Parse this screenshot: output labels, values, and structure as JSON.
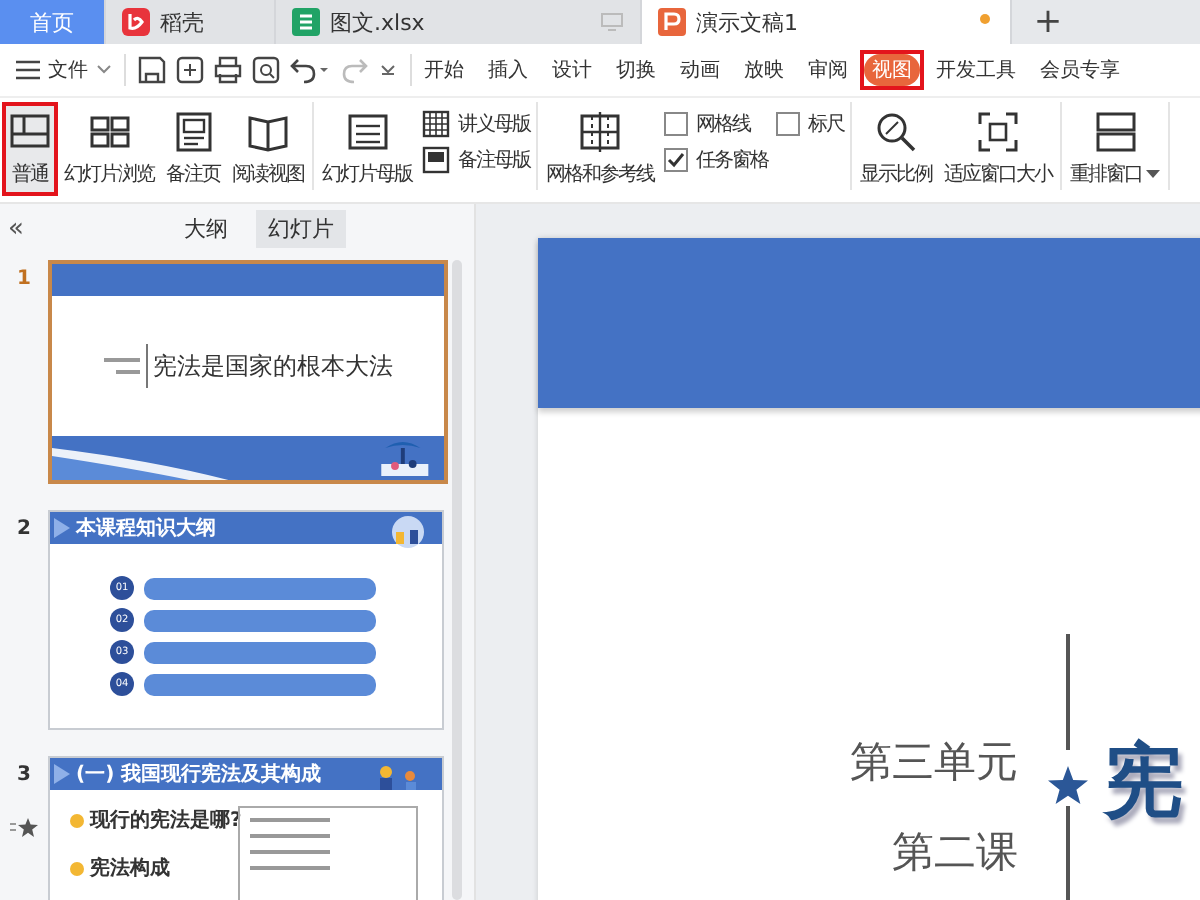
{
  "title_tabs": [
    {
      "label": "首页",
      "kind": "home",
      "selected": false,
      "unsaved": false
    },
    {
      "label": "稻壳",
      "kind": "docer",
      "selected": false,
      "unsaved": false
    },
    {
      "label": "图文.xlsx",
      "kind": "sheet",
      "selected": false,
      "unsaved": false
    },
    {
      "label": "演示文稿1",
      "kind": "slides",
      "selected": true,
      "unsaved": true
    }
  ],
  "new_tab": "+",
  "file_menu": "文件",
  "menu_tabs": [
    {
      "label": "开始",
      "selected": false,
      "highlighted": false
    },
    {
      "label": "插入",
      "selected": false,
      "highlighted": false
    },
    {
      "label": "设计",
      "selected": false,
      "highlighted": false
    },
    {
      "label": "切换",
      "selected": false,
      "highlighted": false
    },
    {
      "label": "动画",
      "selected": false,
      "highlighted": false
    },
    {
      "label": "放映",
      "selected": false,
      "highlighted": false
    },
    {
      "label": "审阅",
      "selected": false,
      "highlighted": false
    },
    {
      "label": "视图",
      "selected": true,
      "highlighted": true
    },
    {
      "label": "开发工具",
      "selected": false,
      "highlighted": false
    },
    {
      "label": "会员专享",
      "selected": false,
      "highlighted": false
    }
  ],
  "ribbon": {
    "groups": [
      {
        "columns": [
          {
            "kind": "large",
            "label": "普通",
            "selected": true,
            "highlighted": true
          },
          {
            "kind": "large",
            "label": "幻灯片浏览",
            "selected": false,
            "highlighted": false
          },
          {
            "kind": "large",
            "label": "备注页",
            "selected": false,
            "highlighted": false
          },
          {
            "kind": "large",
            "label": "阅读视图",
            "selected": false,
            "highlighted": false
          }
        ]
      },
      {
        "columns": [
          {
            "kind": "large",
            "label": "幻灯片母版",
            "selected": false,
            "highlighted": false
          },
          {
            "kind": "stack",
            "items": [
              {
                "kind": "small",
                "label": "讲义母版"
              },
              {
                "kind": "small",
                "label": "备注母版"
              }
            ]
          }
        ]
      },
      {
        "columns": [
          {
            "kind": "large",
            "label": "网格和参考线",
            "selected": false,
            "highlighted": false
          },
          {
            "kind": "stack",
            "items": [
              {
                "kind": "check",
                "label": "网格线",
                "checked": false
              },
              {
                "kind": "check",
                "label": "任务窗格",
                "checked": true
              }
            ]
          },
          {
            "kind": "stack",
            "items": [
              {
                "kind": "check",
                "label": "标尺",
                "checked": false
              }
            ]
          }
        ]
      },
      {
        "columns": [
          {
            "kind": "large",
            "label": "显示比例",
            "selected": false,
            "highlighted": false
          },
          {
            "kind": "large",
            "label": "适应窗口大小",
            "selected": false,
            "highlighted": false
          }
        ]
      },
      {
        "columns": [
          {
            "kind": "large",
            "label": "重排窗口",
            "selected": false,
            "highlighted": false,
            "dropdown": true
          }
        ]
      }
    ]
  },
  "side_panel": {
    "collapse": "«",
    "tabs": [
      {
        "label": "大纲",
        "selected": false
      },
      {
        "label": "幻灯片",
        "selected": true
      }
    ],
    "slides": [
      {
        "number": "1",
        "kind": "title",
        "selected": true,
        "animated": false,
        "title": "宪法是国家的根本大法"
      },
      {
        "number": "2",
        "kind": "outline",
        "selected": false,
        "animated": false,
        "title": "本课程知识大纲",
        "items": [
          "01",
          "02",
          "03",
          "04"
        ]
      },
      {
        "number": "3",
        "kind": "section",
        "selected": false,
        "animated": true,
        "title": "(一) 我国现行宪法及其构成",
        "points": [
          "现行的宪法是哪?",
          "宪法构成"
        ]
      }
    ]
  },
  "slide": {
    "subtitle_lines": [
      "第三单元",
      "第二课"
    ],
    "title": "宪"
  }
}
